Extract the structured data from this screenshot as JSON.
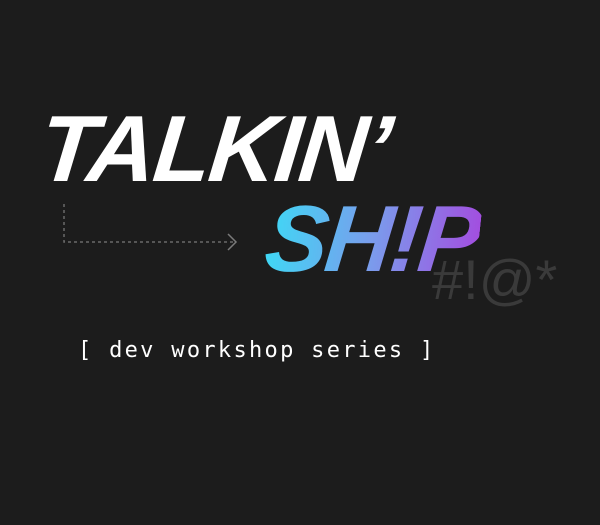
{
  "title_line1": "TALKIN’",
  "title_line2": "SH!P",
  "symbols": "#!@*",
  "subtitle": "[ dev workshop series ]",
  "colors": {
    "background": "#1c1c1c",
    "gradient_start": "#3fd8f5",
    "gradient_end": "#a24fe0",
    "symbols": "#3a3a3a",
    "arrow": "#6a6a6a"
  }
}
